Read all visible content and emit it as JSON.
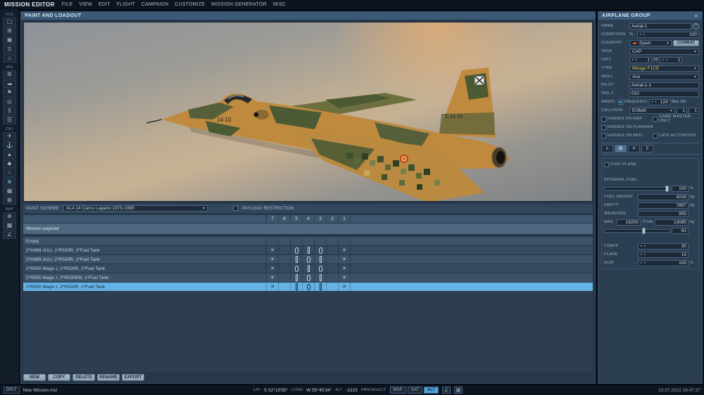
{
  "menubar": {
    "title": "MISSION EDITOR",
    "items": [
      "FILE",
      "VIEW",
      "EDIT",
      "FLIGHT",
      "CAMPAIGN",
      "CUSTOMIZE",
      "MISSION GENERATOR",
      "MISC"
    ]
  },
  "left_toolbar": {
    "sections": [
      {
        "label": "FILE",
        "icons": [
          {
            "name": "new-mission-icon",
            "glyph": "▢"
          },
          {
            "name": "open-mission-icon",
            "glyph": "⊞"
          },
          {
            "name": "save-mission-icon",
            "glyph": "▣"
          },
          {
            "name": "briefing-icon",
            "glyph": "≣"
          },
          {
            "name": "mission-options-icon",
            "glyph": "⌂"
          }
        ]
      },
      {
        "label": "MIS",
        "icons": [
          {
            "name": "settings-icon",
            "glyph": "⚙"
          },
          {
            "name": "weather-icon",
            "glyph": "☁"
          },
          {
            "name": "triggers-icon",
            "glyph": "⚑"
          },
          {
            "name": "goals-icon",
            "glyph": "◎"
          },
          {
            "name": "rules-icon",
            "glyph": "§"
          },
          {
            "name": "lists-icon",
            "glyph": "☰"
          }
        ]
      },
      {
        "label": "OBJ",
        "icons": [
          {
            "name": "airplane-icon",
            "glyph": "✈"
          },
          {
            "name": "ship-icon",
            "glyph": "⚓"
          },
          {
            "name": "vehicle-icon",
            "glyph": "▲"
          },
          {
            "name": "static-object-icon",
            "glyph": "◆"
          },
          {
            "name": "zone-icon",
            "glyph": "○",
            "color": "#7cc35a"
          },
          {
            "name": "template-icon",
            "glyph": "⊕",
            "color": "#6fb3d9"
          },
          {
            "name": "grid-objects-icon",
            "glyph": "▦"
          },
          {
            "name": "delete-object-icon",
            "glyph": "⊠"
          }
        ]
      },
      {
        "label": "MAP",
        "icons": [
          {
            "name": "center-map-icon",
            "glyph": "⊕"
          },
          {
            "name": "map-layers-icon",
            "glyph": "▦"
          },
          {
            "name": "ruler-icon",
            "glyph": "∠"
          }
        ]
      }
    ]
  },
  "paint_panel": {
    "title": "PAINT AND LOADOUT",
    "paint_scheme_label": "PAINT SCHEME",
    "paint_scheme_value": "ALA 14 Camu Lagarto 1975-1990",
    "payload_restriction_label": "PAYLOAD RESTRICTION",
    "aircraft": {
      "nose_code": "14-10",
      "tail_code": "C.14-10"
    },
    "buttons": [
      "NEW",
      "COPY",
      "DELETE",
      "RENAME",
      "EXPORT"
    ]
  },
  "payload_table": {
    "columns": [
      "7",
      "6",
      "5",
      "4",
      "3",
      "2",
      "1"
    ],
    "group_label": "Mission payload",
    "rows": [
      {
        "label": "Empty",
        "cells": [
          "",
          "",
          "",
          "",
          "",
          "",
          ""
        ],
        "selected": false
      },
      {
        "label": "2*AIM9-JULI, 1*R530R, 2*Fuel Tank",
        "cells": [
          "x",
          "",
          "tank",
          "missile",
          "tank",
          "",
          "x"
        ],
        "selected": false
      },
      {
        "label": "2*AIM9-JULI, 2*R530R, 1*Fuel Tank",
        "cells": [
          "x",
          "",
          "missile",
          "tank",
          "missile",
          "",
          "x"
        ],
        "selected": false
      },
      {
        "label": "2*R550 Magic I, 1*R530R, 2*Fuel Tank",
        "cells": [
          "x",
          "",
          "tank",
          "missile",
          "tank",
          "",
          "x"
        ],
        "selected": false
      },
      {
        "label": "2*R550 Magic I, 2*R530EM, 1*Fuel Tank",
        "cells": [
          "x",
          "",
          "missile",
          "tank",
          "missile",
          "",
          "x"
        ],
        "selected": false
      },
      {
        "label": "2*R550 Magic I, 2*R530R, 1*Fuel Tank",
        "cells": [
          "x",
          "",
          "missile",
          "tank",
          "missile",
          "",
          "x"
        ],
        "selected": true
      }
    ]
  },
  "airplane_group": {
    "title": "AIRPLANE GROUP",
    "rows": {
      "name": {
        "label": "NAME",
        "value": "Aerial-1"
      },
      "condition": {
        "label": "CONDITION",
        "unit": "%",
        "value": "100"
      },
      "country": {
        "label": "COUNTRY",
        "value": "Spain",
        "combat": "COMBAT"
      },
      "task": {
        "label": "TASK",
        "value": "CAP"
      },
      "unit": {
        "label": "UNIT",
        "value": "1",
        "of": "OF",
        "total": "1"
      },
      "type": {
        "label": "TYPE",
        "value": "Mirage F1CE"
      },
      "skill": {
        "label": "SKILL",
        "value": "Ace"
      },
      "pilot": {
        "label": "PILOT",
        "value": "Aerial-1-1"
      },
      "tail": {
        "label": "TAIL #",
        "value": "010"
      },
      "radio": {
        "label": "RADIO",
        "freq_label": "FREQUENCY",
        "freq_value": "124",
        "unit1": "MHz",
        "unit2": "AM"
      },
      "callsign": {
        "label": "CALLSIGN",
        "value": "Enfield",
        "num1": "1",
        "num2": "1"
      }
    },
    "checkboxes": {
      "hidden_on_map": "HIDDEN ON MAP",
      "game_master_only": "GAME MASTER ONLY",
      "hidden_on_planner": "HIDDEN ON PLANNER",
      "hidden_on_mfd": "HIDDEN ON MFD",
      "late_activation": "LATE ACTIVATION",
      "civil_plane": "CIVIL PLANE"
    },
    "tabs": [
      {
        "name": "tab-collapse-icon",
        "glyph": "∧"
      },
      {
        "name": "tab-route-icon",
        "glyph": "⊞"
      },
      {
        "name": "tab-loadout-icon",
        "glyph": "✕"
      },
      {
        "name": "tab-summary-icon",
        "glyph": "Σ"
      }
    ],
    "fuel": {
      "internal_fuel_label": "INTERNAL FUEL",
      "internal_fuel_value": "100",
      "internal_fuel_unit": "%",
      "fuel_weight_label": "FUEL WEIGHT",
      "fuel_weight_value": "4243",
      "fuel_weight_unit": "kg",
      "empty_label": "EMPTY",
      "empty_value": "7897",
      "empty_unit": "kg",
      "weapons_label": "WEAPONS",
      "weapons_value": "955",
      "max_label": "MAX",
      "max_value": "16200",
      "total_label": "TOTAL",
      "total_value": "13085",
      "total_unit": "kg",
      "load_percent": "81"
    },
    "countermeasures": {
      "chaff_label": "CHAFF",
      "chaff_value": "30",
      "flare_label": "FLARE",
      "flare_value": "15",
      "gun_label": "GUN",
      "gun_value": "100",
      "gun_unit": "%"
    }
  },
  "statusbar": {
    "mode": "DFLT",
    "mission_name": "New Mission.miz",
    "lat_label": "LAT",
    "lat_value": "S 52°15'55\"",
    "long_label": "LONG",
    "long_value": "W 55°45'34\"",
    "alt_label": "ALT",
    "alt_value": "-1315",
    "pan_select": "PAN/SELECT",
    "buttons": [
      "MAP",
      "SAT",
      "ALT"
    ],
    "active_button": "ALT",
    "datetime": "23.07.2022 16:47:37"
  },
  "colors": {
    "accent": "#4da6d9",
    "selected_row": "#64b2e3",
    "type_text": "#e8c64e",
    "header_bar": "#3b5a77"
  }
}
